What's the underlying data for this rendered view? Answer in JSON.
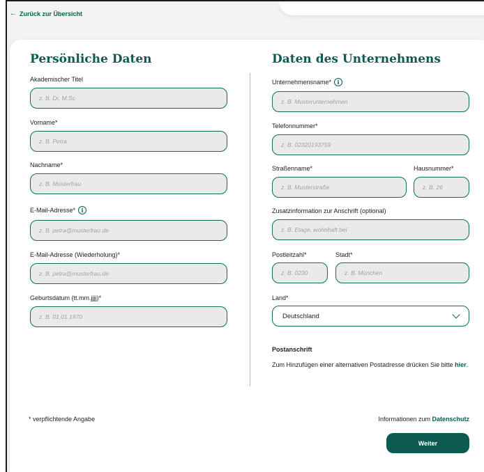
{
  "nav": {
    "back_label": "Zurück zur Übersicht"
  },
  "personal": {
    "title": "Persönliche Daten",
    "academic_title": {
      "label": "Akademischer Titel",
      "placeholder": "z. B. Dr, M.Sc"
    },
    "first_name": {
      "label": "Vorname*",
      "placeholder": "z. B. Petra"
    },
    "last_name": {
      "label": "Nachname*",
      "placeholder": "z. B. Musterfrau"
    },
    "email": {
      "label": "E-Mail-Adresse*",
      "placeholder": "z. B. petra@musterfrau.de"
    },
    "email_repeat": {
      "label": "E-Mail-Adresse (Wiederholung)*",
      "placeholder": "z. B. petra@musterfrau.de"
    },
    "birthdate": {
      "label": "Geburtsdatum (tt.mm.jjjj)*",
      "placeholder": "z. B. 01.01.1970"
    }
  },
  "company": {
    "title": "Daten des Unternehmens",
    "company_name": {
      "label": "Unternehmensname*",
      "placeholder": "z. B. Musterunternehmen"
    },
    "phone": {
      "label": "Telefonnummer*",
      "placeholder": "z. B. 02320193759"
    },
    "street": {
      "label": "Straßenname*",
      "placeholder": "z. B. Musterstraße"
    },
    "house_number": {
      "label": "Hausnummer*",
      "placeholder": "z. B. 26"
    },
    "address_extra": {
      "label": "Zusatzinformation zur Anschrift (optional)",
      "placeholder": "z. B. Etage, wohnhaft bei"
    },
    "postal_code": {
      "label": "Postleitzahl*",
      "placeholder": "z. B. 0230"
    },
    "city": {
      "label": "Stadt*",
      "placeholder": "z. B. München"
    },
    "country": {
      "label": "Land*",
      "value": "Deutschland"
    }
  },
  "postal": {
    "title": "Postanschrift",
    "text": "Zum Hinzufügen einer alternativen Postadresse drücken Sie bitte ",
    "link": "hier",
    "suffix": "."
  },
  "footer": {
    "required_note": "* verpflichtende Angabe",
    "privacy_prefix": "Informationen zum ",
    "privacy_link": "Datenschutz",
    "next_button": "Weiter"
  },
  "icons": {
    "back": "arrow-left-icon",
    "info": "info-icon",
    "dropdown": "chevron-down-icon"
  },
  "colors": {
    "accent": "#0d5a52",
    "input_bg": "#eaeaea",
    "input_border": "#0d6b5f"
  }
}
